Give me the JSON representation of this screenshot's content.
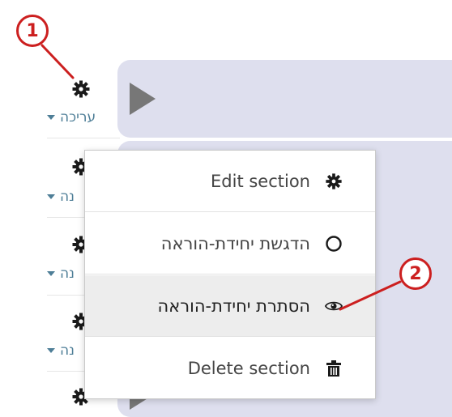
{
  "colors": {
    "panel": "#dedfee",
    "edit_link": "#4e7e97",
    "annotation": "#cc1f1f",
    "hover_row": "#ededed"
  },
  "sections": [
    {
      "gear_icon": "gear-icon",
      "edit_label": "עריכה"
    },
    {
      "gear_icon": "gear-icon",
      "edit_label": "נה"
    },
    {
      "gear_icon": "gear-icon",
      "edit_label": "נה"
    },
    {
      "gear_icon": "gear-icon",
      "edit_label": "נה"
    },
    {
      "gear_icon": "gear-icon",
      "edit_label": ""
    }
  ],
  "action_menu": {
    "items": [
      {
        "label": "Edit section",
        "icon": "gear-icon"
      },
      {
        "label": "הדגשת יחידת-הוראה",
        "icon": "circle-outline-icon"
      },
      {
        "label": "הסתרת יחידת-הוראה",
        "icon": "eye-icon"
      },
      {
        "label": "Delete section",
        "icon": "trash-icon"
      }
    ]
  },
  "annotations": {
    "callout_1": "1",
    "callout_2": "2"
  }
}
